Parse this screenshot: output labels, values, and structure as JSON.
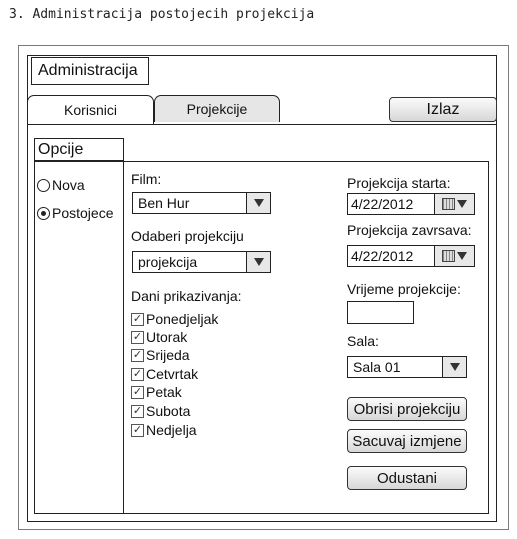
{
  "caption": "3. Administracija postojecih projekcija",
  "app_title": "Administracija",
  "tabs": [
    {
      "label": "Korisnici",
      "active": true
    },
    {
      "label": "Projekcije",
      "active": false
    }
  ],
  "exit_label": "Izlaz",
  "options": {
    "title": "Opcije",
    "items": [
      {
        "label": "Nova",
        "selected": false
      },
      {
        "label": "Postojece",
        "selected": true
      }
    ]
  },
  "film": {
    "label": "Film:",
    "value": "Ben Hur"
  },
  "projection_select": {
    "label": "Odaberi projekciju",
    "value": "projekcija"
  },
  "days": {
    "label": "Dani prikazivanja:",
    "items": [
      {
        "label": "Ponedjeljak",
        "checked": true
      },
      {
        "label": "Utorak",
        "checked": true
      },
      {
        "label": "Srijeda",
        "checked": true
      },
      {
        "label": "Cetvrtak",
        "checked": true
      },
      {
        "label": "Petak",
        "checked": true
      },
      {
        "label": "Subota",
        "checked": true
      },
      {
        "label": "Nedjelja",
        "checked": true
      }
    ]
  },
  "start": {
    "label": "Projekcija starta:",
    "value": "4/22/2012"
  },
  "end": {
    "label": "Projekcija zavrsava:",
    "value": "4/22/2012"
  },
  "time": {
    "label": "Vrijeme projekcije:",
    "value": ""
  },
  "hall": {
    "label": "Sala:",
    "value": "Sala 01"
  },
  "buttons": {
    "delete": "Obrisi projekciju",
    "save": "Sacuvaj izmjene",
    "cancel": "Odustani"
  },
  "icons": {
    "dropdown": "chevron-down-icon",
    "calendar": "calendar-icon",
    "check": "checkmark-icon"
  }
}
